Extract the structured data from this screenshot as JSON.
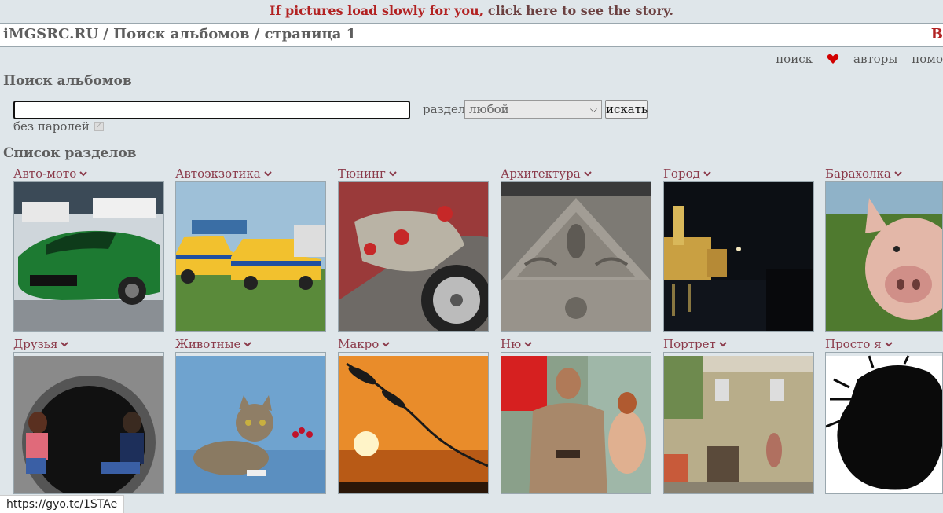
{
  "banner": {
    "highlight": "If pictures load slowly for you,",
    "rest": " click here to see the story."
  },
  "header": {
    "title": "iMGSRC.RU / Поиск альбомов / страница 1",
    "right_link": "B"
  },
  "nav": {
    "search": "поиск",
    "authors": "авторы",
    "help": "помо"
  },
  "search_section": {
    "title": "Поиск альбомов",
    "query_value": "",
    "section_label": "раздел",
    "section_selected": "любой",
    "button_label": "искать",
    "no_passwords_label": "без паролей"
  },
  "categories_title": "Список разделов",
  "categories": [
    {
      "label": "Авто-мото",
      "image": "car-photo"
    },
    {
      "label": "Автоэкзотика",
      "image": "retro-cars-photo"
    },
    {
      "label": "Тюнинг",
      "image": "tuning-photo"
    },
    {
      "label": "Архитектура",
      "image": "architecture-photo"
    },
    {
      "label": "Город",
      "image": "night-city-photo"
    },
    {
      "label": "Барахолка",
      "image": "pig-photo"
    },
    {
      "label": "Друзья",
      "image": "friends-photo"
    },
    {
      "label": "Животные",
      "image": "cat-photo"
    },
    {
      "label": "Макро",
      "image": "sunset-grass-photo"
    },
    {
      "label": "Ню",
      "image": "poster-photo"
    },
    {
      "label": "Портрет",
      "image": "old-building-photo"
    },
    {
      "label": "Просто я",
      "image": "silhouette-photo"
    }
  ],
  "status_url": "https://gyo.tc/1STAe",
  "colors": {
    "accent": "#b22222",
    "category_link": "#8b3a4a",
    "background": "#dfe6ea"
  }
}
